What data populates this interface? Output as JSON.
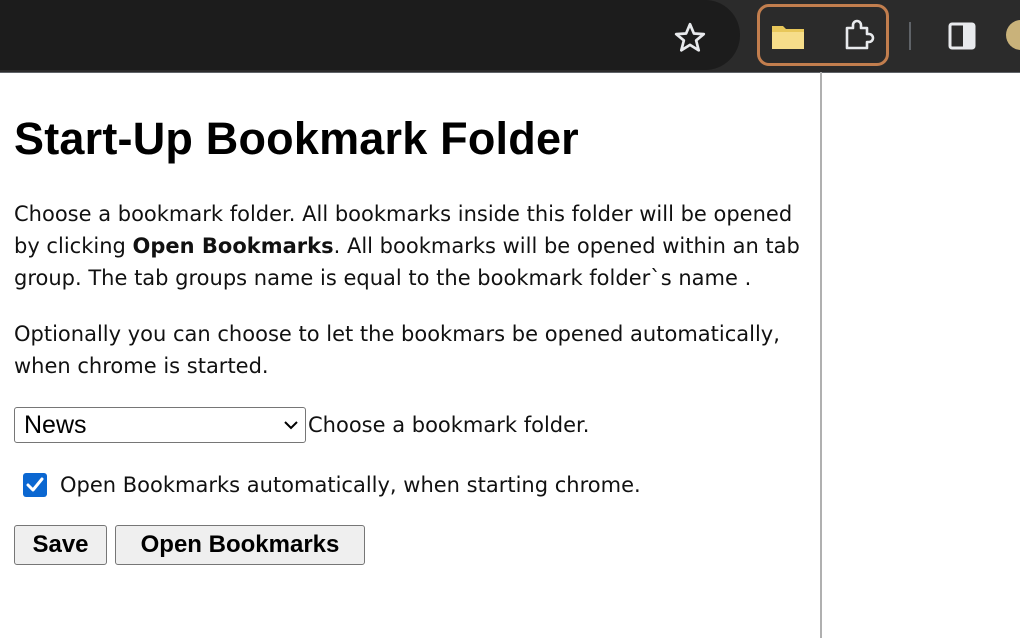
{
  "toolbar": {
    "icons": [
      "star-icon",
      "folder-icon",
      "puzzle-icon",
      "side-panel-icon",
      "avatar"
    ],
    "highlight_color": "#c27e4e"
  },
  "page": {
    "title": "Start-Up Bookmark Folder",
    "intro_part1": "Choose a bookmark folder. All bookmarks inside this folder will be opened by clicking ",
    "intro_bold": "Open Bookmarks",
    "intro_part2": ". All bookmarks will be opened within an tab group. The tab groups name is equal to the bookmark folder`s name .",
    "optional_text": "Optionally you can choose to let the bookmars be opened automatically, when chrome is started."
  },
  "folder_select": {
    "value": "News",
    "label": "Choose a bookmark folder."
  },
  "auto_open": {
    "checked": true,
    "label": "Open Bookmarks automatically, when starting chrome.",
    "color": "#0b67d1"
  },
  "buttons": {
    "save": "Save",
    "open": "Open Bookmarks"
  }
}
